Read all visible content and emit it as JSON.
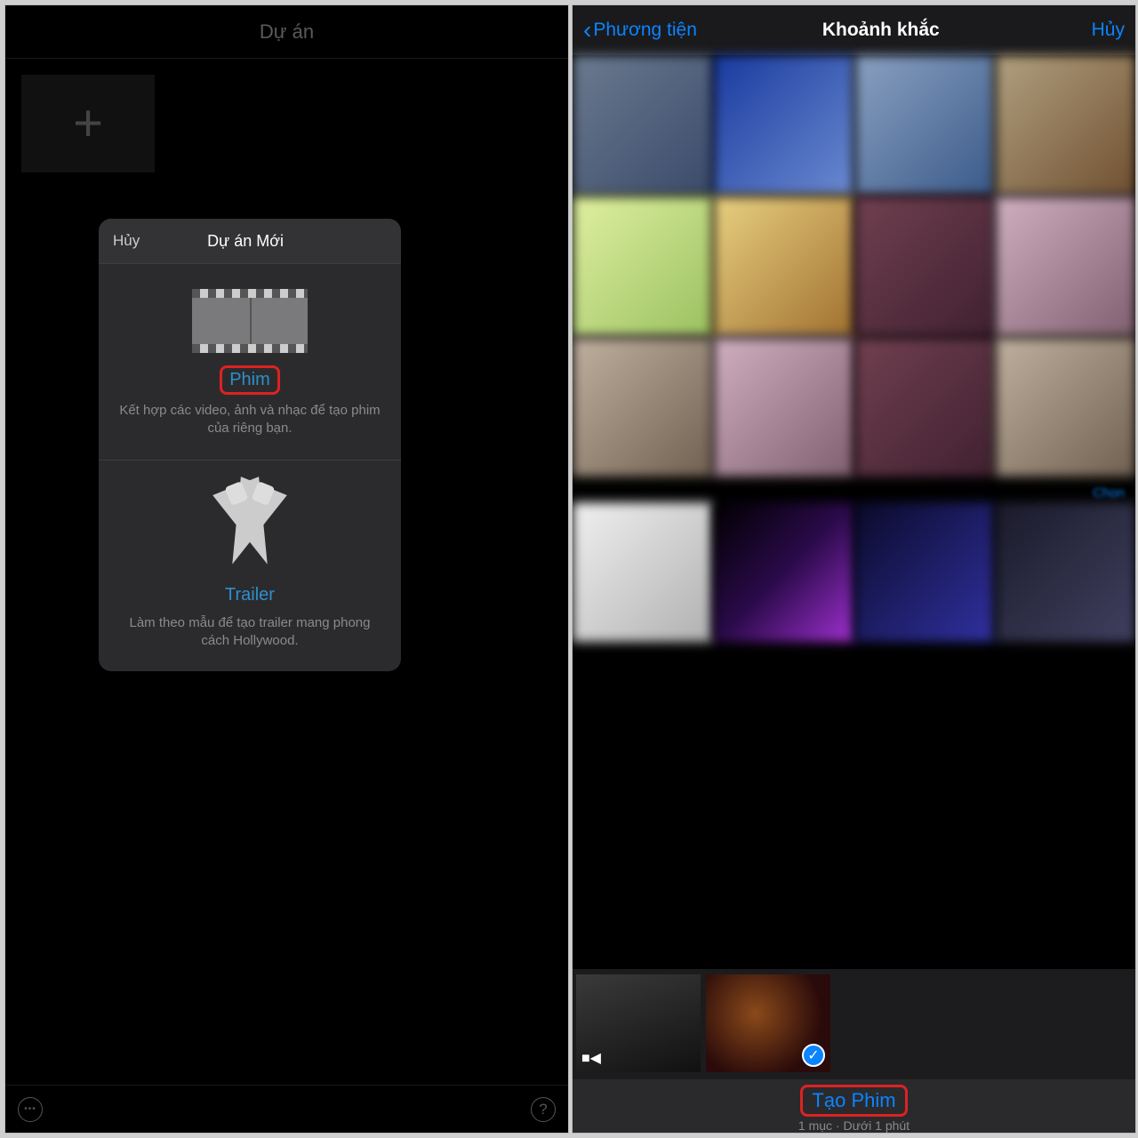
{
  "left": {
    "header_title": "Dự án",
    "sheet": {
      "cancel": "Hủy",
      "title": "Dự án Mới",
      "movie": {
        "title": "Phim",
        "desc": "Kết hợp các video, ảnh và nhạc để tạo phim của riêng bạn."
      },
      "trailer": {
        "title": "Trailer",
        "desc": "Làm theo mẫu để tạo trailer mang phong cách Hollywood."
      }
    }
  },
  "right": {
    "back_label": "Phương tiện",
    "title": "Khoảnh khắc",
    "cancel": "Hủy",
    "select_all": "Chọn",
    "create": "Tạo Phim",
    "footer_sub": "1 mục · Dưới 1 phút"
  }
}
